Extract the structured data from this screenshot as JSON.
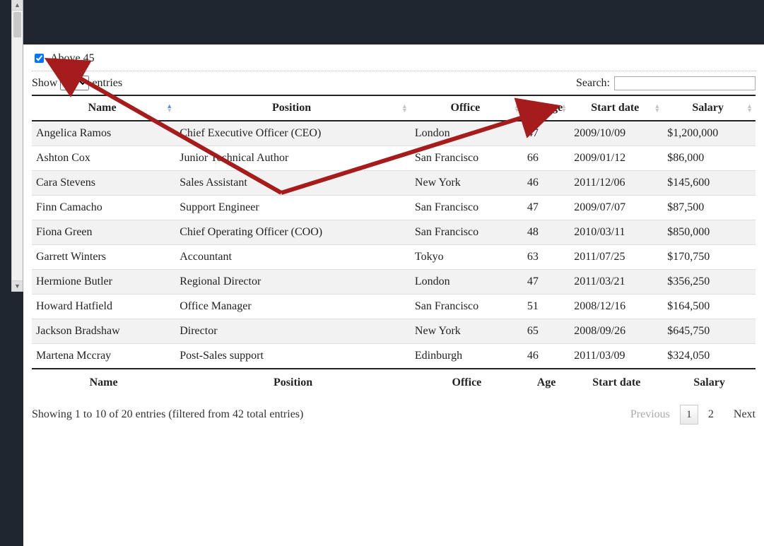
{
  "filter": {
    "label": "Above 45",
    "checked": true
  },
  "length": {
    "prefix": "Show",
    "suffix": "entries",
    "value": "10"
  },
  "search": {
    "label": "Search:",
    "value": ""
  },
  "columns": [
    {
      "label": "Name",
      "sort": "asc"
    },
    {
      "label": "Position",
      "sort": "both"
    },
    {
      "label": "Office",
      "sort": "both"
    },
    {
      "label": "Age",
      "sort": "both"
    },
    {
      "label": "Start date",
      "sort": "both"
    },
    {
      "label": "Salary",
      "sort": "both"
    }
  ],
  "footer": [
    "Name",
    "Position",
    "Office",
    "Age",
    "Start date",
    "Salary"
  ],
  "rows": [
    {
      "name": "Angelica Ramos",
      "position": "Chief Executive Officer (CEO)",
      "office": "London",
      "age": "47",
      "start": "2009/10/09",
      "salary": "$1,200,000"
    },
    {
      "name": "Ashton Cox",
      "position": "Junior Technical Author",
      "office": "San Francisco",
      "age": "66",
      "start": "2009/01/12",
      "salary": "$86,000"
    },
    {
      "name": "Cara Stevens",
      "position": "Sales Assistant",
      "office": "New York",
      "age": "46",
      "start": "2011/12/06",
      "salary": "$145,600"
    },
    {
      "name": "Finn Camacho",
      "position": "Support Engineer",
      "office": "San Francisco",
      "age": "47",
      "start": "2009/07/07",
      "salary": "$87,500"
    },
    {
      "name": "Fiona Green",
      "position": "Chief Operating Officer (COO)",
      "office": "San Francisco",
      "age": "48",
      "start": "2010/03/11",
      "salary": "$850,000"
    },
    {
      "name": "Garrett Winters",
      "position": "Accountant",
      "office": "Tokyo",
      "age": "63",
      "start": "2011/07/25",
      "salary": "$170,750"
    },
    {
      "name": "Hermione Butler",
      "position": "Regional Director",
      "office": "London",
      "age": "47",
      "start": "2011/03/21",
      "salary": "$356,250"
    },
    {
      "name": "Howard Hatfield",
      "position": "Office Manager",
      "office": "San Francisco",
      "age": "51",
      "start": "2008/12/16",
      "salary": "$164,500"
    },
    {
      "name": "Jackson Bradshaw",
      "position": "Director",
      "office": "New York",
      "age": "65",
      "start": "2008/09/26",
      "salary": "$645,750"
    },
    {
      "name": "Martena Mccray",
      "position": "Post-Sales support",
      "office": "Edinburgh",
      "age": "46",
      "start": "2011/03/09",
      "salary": "$324,050"
    }
  ],
  "info": "Showing 1 to 10 of 20 entries (filtered from 42 total entries)",
  "paginate": {
    "previous": "Previous",
    "next": "Next",
    "pages": [
      "1",
      "2"
    ],
    "current": "1"
  }
}
